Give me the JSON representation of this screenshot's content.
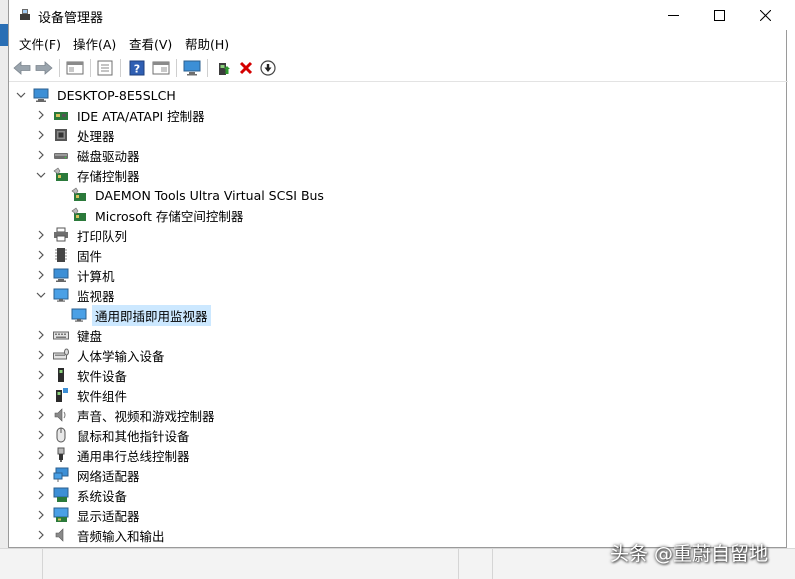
{
  "window": {
    "title": "设备管理器"
  },
  "menu": [
    {
      "label": "文件(F)"
    },
    {
      "label": "操作(A)"
    },
    {
      "label": "查看(V)"
    },
    {
      "label": "帮助(H)"
    }
  ],
  "toolbar_icons": [
    "back-arrow-icon",
    "forward-arrow-icon",
    "show-hide-tree-icon",
    "properties-icon",
    "help-icon",
    "view-icon",
    "monitor-scan-icon",
    "update-driver-icon",
    "uninstall-icon",
    "disable-device-icon"
  ],
  "colors": {
    "selection": "#cce8ff",
    "uninstall_red": "#d40000",
    "accent_blue": "#2a6fb5"
  },
  "tree": {
    "root": "DESKTOP-8E5SLCH",
    "items": [
      {
        "label": "IDE ATA/ATAPI 控制器",
        "icon": "ide-controller-icon",
        "expanded": false
      },
      {
        "label": "处理器",
        "icon": "processor-icon",
        "expanded": false
      },
      {
        "label": "磁盘驱动器",
        "icon": "disk-drive-icon",
        "expanded": false
      },
      {
        "label": "存储控制器",
        "icon": "storage-controller-icon",
        "expanded": true,
        "children": [
          {
            "label": "DAEMON Tools Ultra Virtual SCSI Bus",
            "icon": "storage-controller-icon"
          },
          {
            "label": "Microsoft 存储空间控制器",
            "icon": "storage-controller-icon"
          }
        ]
      },
      {
        "label": "打印队列",
        "icon": "printer-icon",
        "expanded": false
      },
      {
        "label": "固件",
        "icon": "firmware-icon",
        "expanded": false
      },
      {
        "label": "计算机",
        "icon": "computer-icon",
        "expanded": false
      },
      {
        "label": "监视器",
        "icon": "monitor-icon",
        "expanded": true,
        "children": [
          {
            "label": "通用即插即用监视器",
            "icon": "monitor-icon",
            "selected": true
          }
        ]
      },
      {
        "label": "键盘",
        "icon": "keyboard-icon",
        "expanded": false
      },
      {
        "label": "人体学输入设备",
        "icon": "hid-icon",
        "expanded": false
      },
      {
        "label": "软件设备",
        "icon": "software-device-icon",
        "expanded": false
      },
      {
        "label": "软件组件",
        "icon": "software-component-icon",
        "expanded": false
      },
      {
        "label": "声音、视频和游戏控制器",
        "icon": "speaker-icon",
        "expanded": false
      },
      {
        "label": "鼠标和其他指针设备",
        "icon": "mouse-icon",
        "expanded": false
      },
      {
        "label": "通用串行总线控制器",
        "icon": "usb-icon",
        "expanded": false
      },
      {
        "label": "网络适配器",
        "icon": "network-adapter-icon",
        "expanded": false
      },
      {
        "label": "系统设备",
        "icon": "system-device-icon",
        "expanded": false
      },
      {
        "label": "显示适配器",
        "icon": "display-adapter-icon",
        "expanded": false
      },
      {
        "label": "音频输入和输出",
        "icon": "audio-io-icon",
        "expanded": false
      }
    ]
  },
  "watermark": "头条 @重蔚自留地"
}
